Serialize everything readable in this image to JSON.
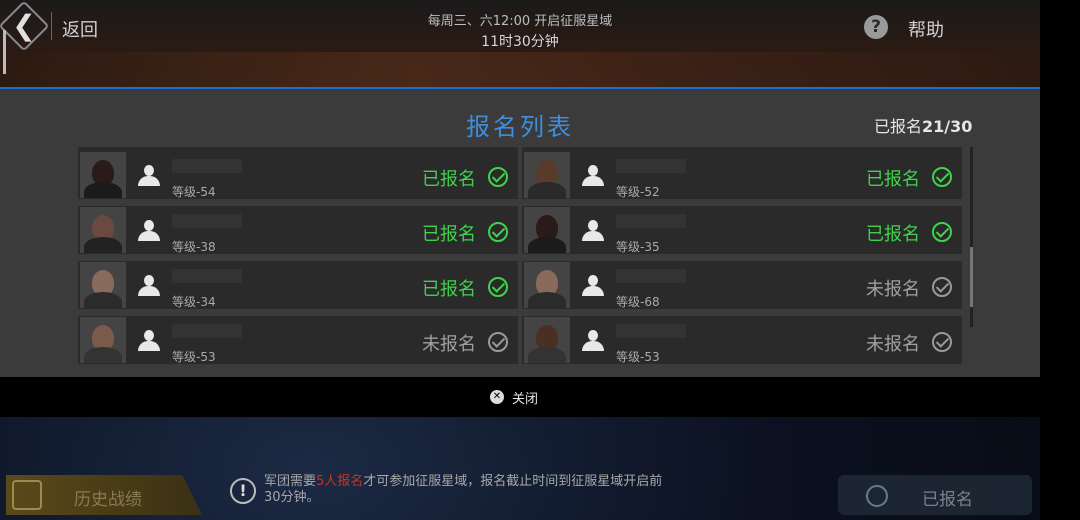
{
  "header": {
    "back_label": "返回",
    "schedule_line1": "每周三、六12:00 开启征服星域",
    "schedule_line2": "11时30分钟",
    "help_label": "帮助"
  },
  "panel": {
    "title": "报名列表",
    "count_label": "已报名",
    "count_value": "21/30",
    "close_label": "关闭"
  },
  "registrants": [
    {
      "level": "等级-54",
      "status": "已报名",
      "registered": true
    },
    {
      "level": "等级-52",
      "status": "已报名",
      "registered": true
    },
    {
      "level": "等级-38",
      "status": "已报名",
      "registered": true
    },
    {
      "level": "等级-35",
      "status": "已报名",
      "registered": true
    },
    {
      "level": "等级-34",
      "status": "已报名",
      "registered": true
    },
    {
      "level": "等级-68",
      "status": "未报名",
      "registered": false
    },
    {
      "level": "等级-53",
      "status": "未报名",
      "registered": false
    },
    {
      "level": "等级-53",
      "status": "未报名",
      "registered": false
    }
  ],
  "bottom": {
    "history_label": "历史战绩",
    "notice_prefix": "军团需要",
    "notice_required": "5人报名",
    "notice_suffix": "才可参加征服星域，报名截止时间到征服星域开启前",
    "notice_line2": "30分钟。",
    "signed_label": "已报名"
  },
  "colors": {
    "accent_blue": "#3e8ede",
    "registered_green": "#3fd24c",
    "unregistered_gray": "#a0a0a0",
    "warning_red": "#c8322a"
  }
}
